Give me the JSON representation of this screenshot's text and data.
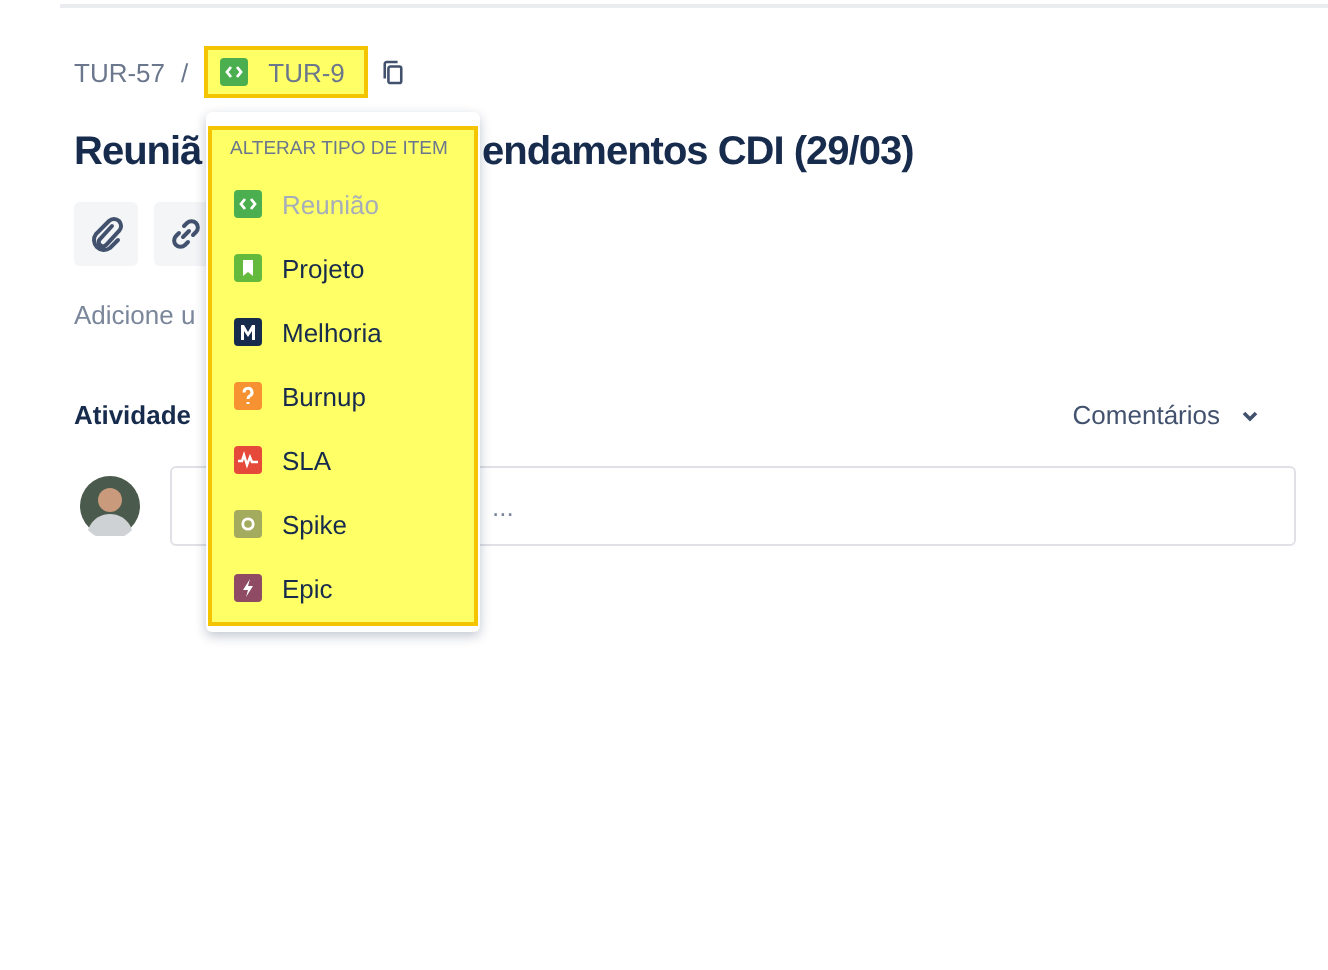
{
  "breadcrumb": {
    "parent": "TUR-57",
    "separator": "/",
    "current": "TUR-9"
  },
  "title": {
    "start": "Reuniã",
    "end": "endamentos CDI (29/03)"
  },
  "description_placeholder": "Adicione u",
  "activity": {
    "label": "Atividade",
    "filter": "Comentários",
    "comment_placeholder": "..."
  },
  "type_menu": {
    "heading": "ALTERAR TIPO DE ITEM",
    "items": [
      {
        "label": "Reunião",
        "kind": "code",
        "color": "#4bae4f",
        "disabled": true
      },
      {
        "label": "Projeto",
        "kind": "bookmark",
        "color": "#63ba3c",
        "disabled": false
      },
      {
        "label": "Melhoria",
        "kind": "letter",
        "color": "#172b4d",
        "disabled": false
      },
      {
        "label": "Burnup",
        "kind": "question",
        "color": "#f79232",
        "disabled": false
      },
      {
        "label": "SLA",
        "kind": "pulse",
        "color": "#e5493a",
        "disabled": false
      },
      {
        "label": "Spike",
        "kind": "circle",
        "color": "#a3ab5e",
        "disabled": false
      },
      {
        "label": "Epic",
        "kind": "bolt",
        "color": "#8e4b63",
        "disabled": false
      }
    ]
  }
}
